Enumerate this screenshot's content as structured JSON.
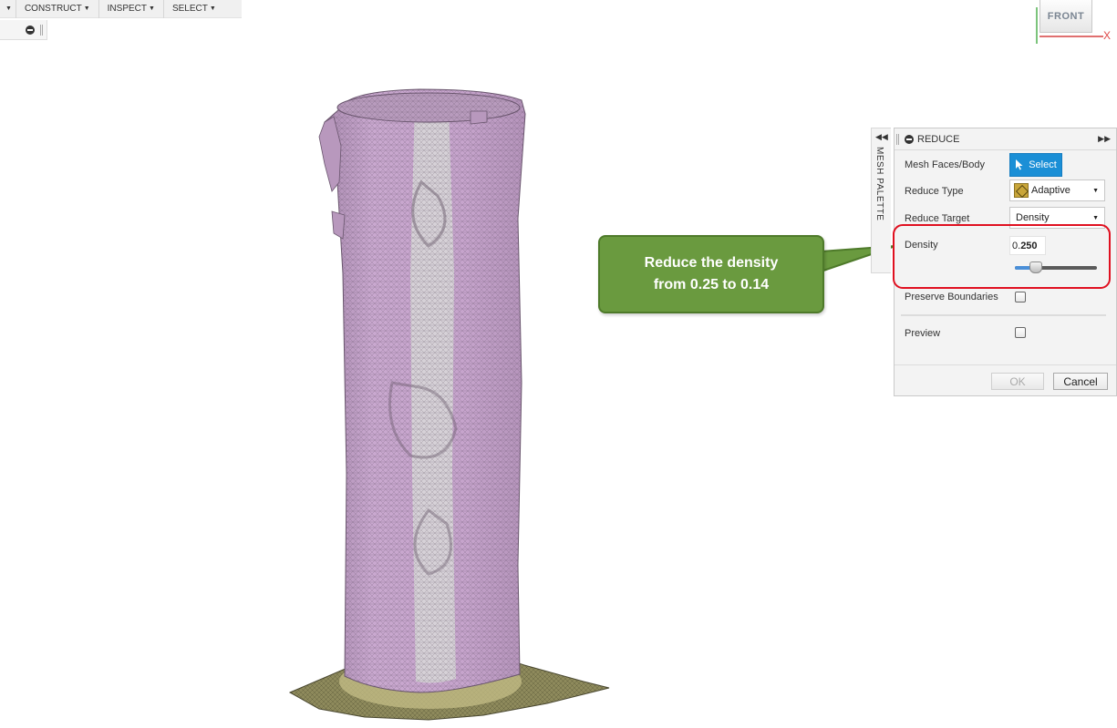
{
  "toolbar": {
    "menus": [
      {
        "label": "",
        "has_caret": true
      },
      {
        "label": "CONSTRUCT",
        "has_caret": true
      },
      {
        "label": "INSPECT",
        "has_caret": true
      },
      {
        "label": "SELECT",
        "has_caret": true
      }
    ]
  },
  "viewcube": {
    "face_label": "FRONT",
    "axis_x_label": "X"
  },
  "mesh_palette": {
    "label": "MESH PALETTE",
    "collapse_icon": "double-chevron-left-icon"
  },
  "dialog": {
    "title": "REDUCE",
    "rows": {
      "mesh_faces_label": "Mesh Faces/Body",
      "select_button": "Select",
      "reduce_type_label": "Reduce Type",
      "reduce_type_value": "Adaptive",
      "reduce_target_label": "Reduce Target",
      "reduce_target_value": "Density",
      "density_label": "Density",
      "density_value_prefix": "0.",
      "density_value_bold": "250",
      "density_slider": 0.25,
      "preserve_boundaries_label": "Preserve Boundaries",
      "preserve_boundaries_checked": false,
      "preview_label": "Preview",
      "preview_checked": false
    },
    "ok_label": "OK",
    "cancel_label": "Cancel"
  },
  "callout": {
    "line1": "Reduce the density",
    "line2": "from 0.25 to 0.14"
  },
  "colors": {
    "mesh_body": "#c9a8cf",
    "mesh_stripe": "#d6d6d6",
    "mesh_base": "#8e8a5c",
    "callout_fill": "#6a9a3f",
    "select_blue": "#1b8fd6",
    "highlight_red": "#e01020"
  }
}
